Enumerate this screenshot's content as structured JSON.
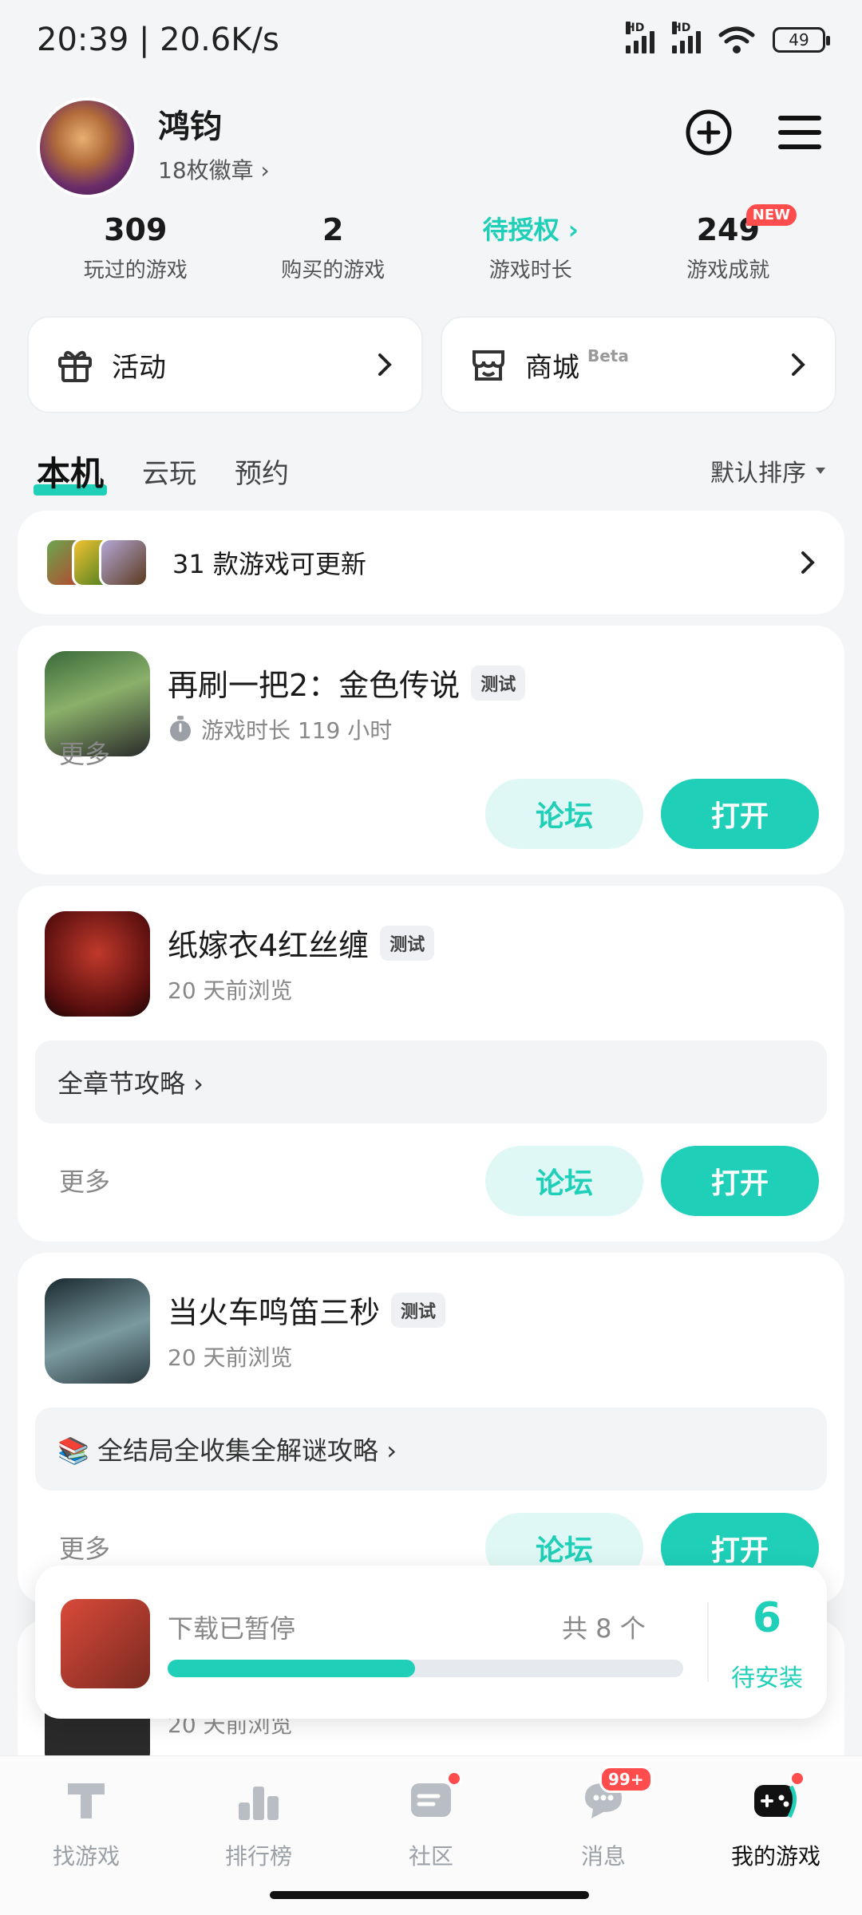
{
  "status_bar": {
    "time": "20:39 | 20.6K/s",
    "battery": "49"
  },
  "profile": {
    "username": "鸿钧",
    "badges": "18枚徽章 ›"
  },
  "stats": [
    {
      "value": "309",
      "label": "玩过的游戏"
    },
    {
      "value": "2",
      "label": "购买的游戏"
    },
    {
      "value": "待授权 ›",
      "label": "游戏时长"
    },
    {
      "value": "249",
      "label": "游戏成就",
      "badge": "NEW"
    }
  ],
  "quick_links": {
    "activity": "活动",
    "store": "商城",
    "store_tag": "Beta"
  },
  "tabs": [
    "本机",
    "云玩",
    "预约"
  ],
  "sort_label": "默认排序",
  "update_bar": {
    "text": "31 款游戏可更新"
  },
  "games": [
    {
      "title": "再刷一把2：金色传说",
      "tag": "测试",
      "subtitle": "游戏时长 119 小时",
      "more": "更多",
      "forum": "论坛",
      "open": "打开"
    },
    {
      "title": "纸嫁衣4红丝缠",
      "tag": "测试",
      "subtitle": "20 天前浏览",
      "guide": "全章节攻略 ›",
      "more": "更多",
      "forum": "论坛",
      "open": "打开"
    },
    {
      "title": "当火车鸣笛三秒",
      "tag": "测试",
      "subtitle": "20 天前浏览",
      "guide": "📚 全结局全收集全解谜攻略 ›",
      "more": "更多",
      "forum": "论坛",
      "open": "打开"
    }
  ],
  "peek_game": {
    "subtitle": "20 天前浏览"
  },
  "download": {
    "status": "下载已暂停",
    "total": "共 8 个",
    "progress": 0.48,
    "pending_count": "6",
    "pending_label": "待安装"
  },
  "bottom_nav": [
    {
      "label": "找游戏",
      "icon": "find-games-icon"
    },
    {
      "label": "排行榜",
      "icon": "ranking-icon"
    },
    {
      "label": "社区",
      "icon": "community-icon"
    },
    {
      "label": "消息",
      "icon": "message-icon",
      "badge": "99+"
    },
    {
      "label": "我的游戏",
      "icon": "my-games-icon"
    }
  ],
  "colors": {
    "accent": "#1fcfb8",
    "badge_red": "#ff4d4d"
  }
}
